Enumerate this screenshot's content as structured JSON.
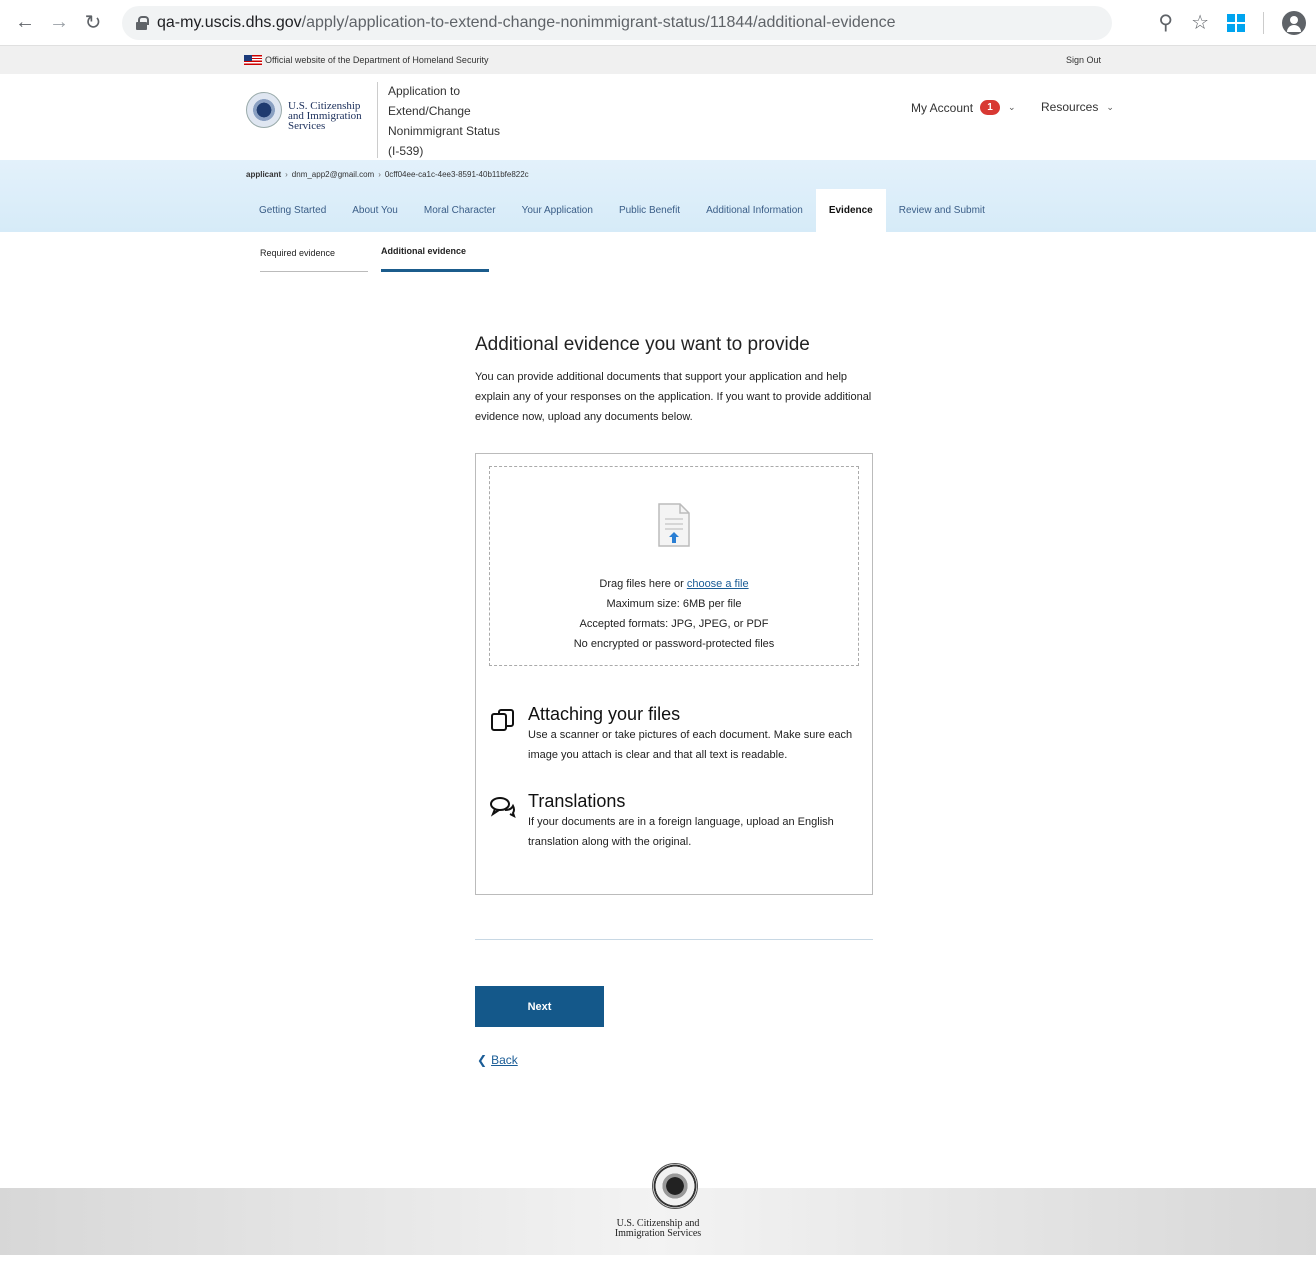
{
  "browser": {
    "url_host": "qa-my.uscis.dhs.gov",
    "url_path": "/apply/application-to-extend-change-nonimmigrant-status/11844/additional-evidence"
  },
  "banner": {
    "official": "Official website of the Department of Homeland Security",
    "sign_out": "Sign Out"
  },
  "header": {
    "agency_line1": "U.S. Citizenship",
    "agency_line2": "and Immigration",
    "agency_line3": "Services",
    "app_title_line1": "Application to",
    "app_title_line2": "Extend/Change",
    "app_title_line3": "Nonimmigrant Status",
    "app_title_line4": "(I-539)",
    "my_account": "My Account",
    "notification_count": "1",
    "resources": "Resources"
  },
  "breadcrumb": {
    "role": "applicant",
    "email": "dnm_app2@gmail.com",
    "id": "0cff04ee-ca1c-4ee3-8591-40b11bfe822c"
  },
  "tabs": [
    {
      "label": "Getting Started"
    },
    {
      "label": "About You"
    },
    {
      "label": "Moral Character"
    },
    {
      "label": "Your Application"
    },
    {
      "label": "Public Benefit"
    },
    {
      "label": "Additional Information"
    },
    {
      "label": "Evidence"
    },
    {
      "label": "Review and Submit"
    }
  ],
  "subtabs": {
    "required": "Required evidence",
    "additional": "Additional evidence"
  },
  "main": {
    "title": "Additional evidence you want to provide",
    "intro": "You can provide additional documents that support your application and help explain any of your responses on the application. If you want to provide additional evidence now, upload any documents below."
  },
  "dropzone": {
    "drag_text": "Drag files here or ",
    "choose_link": "choose a file",
    "max_size": "Maximum size: 6MB per file",
    "formats": "Accepted formats: JPG, JPEG, or PDF",
    "encrypted": "No encrypted or password-protected files"
  },
  "info": {
    "attaching_title": "Attaching your files",
    "attaching_text": "Use a scanner or take pictures of each document. Make sure each image you attach is clear and that all text is readable.",
    "translations_title": "Translations",
    "translations_text": "If your documents are in a foreign language, upload an English translation along with the original."
  },
  "actions": {
    "next": "Next",
    "back": "Back"
  },
  "footer": {
    "line1": "U.S. Citizenship and",
    "line2": "Immigration Services"
  }
}
